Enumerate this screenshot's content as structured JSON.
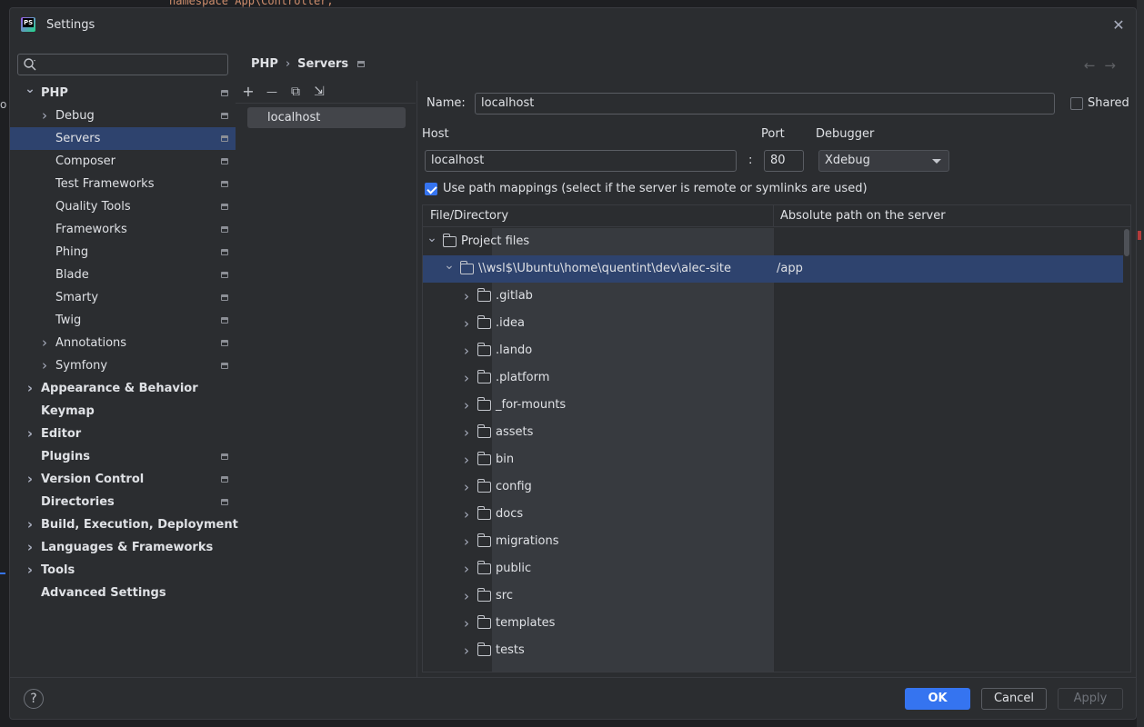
{
  "background": {
    "code_line": "namespace App\\Controller;",
    "left_fragment": "o"
  },
  "dialog": {
    "title": "Settings",
    "app_icon_text": "PS"
  },
  "search": {
    "placeholder": ""
  },
  "tree": [
    {
      "label": "PHP",
      "bold": true,
      "chevron": "down",
      "indent": 0,
      "proj_icon": true,
      "selected": false
    },
    {
      "label": "Debug",
      "bold": false,
      "chevron": "right",
      "indent": 1,
      "proj_icon": true,
      "selected": false
    },
    {
      "label": "Servers",
      "bold": false,
      "chevron": "",
      "indent": 1,
      "proj_icon": true,
      "selected": true
    },
    {
      "label": "Composer",
      "bold": false,
      "chevron": "",
      "indent": 1,
      "proj_icon": true,
      "selected": false
    },
    {
      "label": "Test Frameworks",
      "bold": false,
      "chevron": "",
      "indent": 1,
      "proj_icon": true,
      "selected": false
    },
    {
      "label": "Quality Tools",
      "bold": false,
      "chevron": "",
      "indent": 1,
      "proj_icon": true,
      "selected": false
    },
    {
      "label": "Frameworks",
      "bold": false,
      "chevron": "",
      "indent": 1,
      "proj_icon": true,
      "selected": false
    },
    {
      "label": "Phing",
      "bold": false,
      "chevron": "",
      "indent": 1,
      "proj_icon": true,
      "selected": false
    },
    {
      "label": "Blade",
      "bold": false,
      "chevron": "",
      "indent": 1,
      "proj_icon": true,
      "selected": false
    },
    {
      "label": "Smarty",
      "bold": false,
      "chevron": "",
      "indent": 1,
      "proj_icon": true,
      "selected": false
    },
    {
      "label": "Twig",
      "bold": false,
      "chevron": "",
      "indent": 1,
      "proj_icon": true,
      "selected": false
    },
    {
      "label": "Annotations",
      "bold": false,
      "chevron": "right",
      "indent": 1,
      "proj_icon": true,
      "selected": false
    },
    {
      "label": "Symfony",
      "bold": false,
      "chevron": "right",
      "indent": 1,
      "proj_icon": true,
      "selected": false
    },
    {
      "label": "Appearance & Behavior",
      "bold": true,
      "chevron": "right",
      "indent": 0,
      "proj_icon": false,
      "selected": false
    },
    {
      "label": "Keymap",
      "bold": true,
      "chevron": "",
      "indent": 0,
      "proj_icon": false,
      "selected": false
    },
    {
      "label": "Editor",
      "bold": true,
      "chevron": "right",
      "indent": 0,
      "proj_icon": false,
      "selected": false
    },
    {
      "label": "Plugins",
      "bold": true,
      "chevron": "",
      "indent": 0,
      "proj_icon": true,
      "selected": false
    },
    {
      "label": "Version Control",
      "bold": true,
      "chevron": "right",
      "indent": 0,
      "proj_icon": true,
      "selected": false
    },
    {
      "label": "Directories",
      "bold": true,
      "chevron": "",
      "indent": 0,
      "proj_icon": true,
      "selected": false
    },
    {
      "label": "Build, Execution, Deployment",
      "bold": true,
      "chevron": "right",
      "indent": 0,
      "proj_icon": false,
      "selected": false
    },
    {
      "label": "Languages & Frameworks",
      "bold": true,
      "chevron": "right",
      "indent": 0,
      "proj_icon": false,
      "selected": false
    },
    {
      "label": "Tools",
      "bold": true,
      "chevron": "right",
      "indent": 0,
      "proj_icon": false,
      "selected": false
    },
    {
      "label": "Advanced Settings",
      "bold": true,
      "chevron": "",
      "indent": 0,
      "proj_icon": false,
      "selected": false
    }
  ],
  "breadcrumb": {
    "parent": "PHP",
    "separator": "›",
    "current": "Servers"
  },
  "nav": {
    "back": "←",
    "forward": "→"
  },
  "servers_toolbar": {
    "add": "+",
    "remove": "—",
    "copy": "⧉",
    "import": "⇲"
  },
  "servers": [
    "localhost"
  ],
  "form": {
    "name_label": "Name:",
    "name_value": "localhost",
    "shared_label": "Shared",
    "shared_checked": false,
    "host_label": "Host",
    "host_value": "localhost",
    "colon": ":",
    "port_label": "Port",
    "port_value": "80",
    "debugger_label": "Debugger",
    "debugger_value": "Xdebug",
    "path_mappings_label": "Use path mappings (select if the server is remote or symlinks are used)",
    "path_mappings_checked": true
  },
  "mapping_table": {
    "col_file": "File/Directory",
    "col_server": "Absolute path on the server",
    "rows": [
      {
        "name": "Project files",
        "level": 0,
        "chevron": "down",
        "server_path": "",
        "selected": false
      },
      {
        "name": "\\\\wsl$\\Ubuntu\\home\\quentint\\dev\\alec-site",
        "level": 1,
        "chevron": "down",
        "server_path": "/app",
        "selected": true
      },
      {
        "name": ".gitlab",
        "level": 2,
        "chevron": "right",
        "server_path": "",
        "selected": false
      },
      {
        "name": ".idea",
        "level": 2,
        "chevron": "right",
        "server_path": "",
        "selected": false
      },
      {
        "name": ".lando",
        "level": 2,
        "chevron": "right",
        "server_path": "",
        "selected": false
      },
      {
        "name": ".platform",
        "level": 2,
        "chevron": "right",
        "server_path": "",
        "selected": false
      },
      {
        "name": "_for-mounts",
        "level": 2,
        "chevron": "right",
        "server_path": "",
        "selected": false
      },
      {
        "name": "assets",
        "level": 2,
        "chevron": "right",
        "server_path": "",
        "selected": false
      },
      {
        "name": "bin",
        "level": 2,
        "chevron": "right",
        "server_path": "",
        "selected": false
      },
      {
        "name": "config",
        "level": 2,
        "chevron": "right",
        "server_path": "",
        "selected": false
      },
      {
        "name": "docs",
        "level": 2,
        "chevron": "right",
        "server_path": "",
        "selected": false
      },
      {
        "name": "migrations",
        "level": 2,
        "chevron": "right",
        "server_path": "",
        "selected": false
      },
      {
        "name": "public",
        "level": 2,
        "chevron": "right",
        "server_path": "",
        "selected": false
      },
      {
        "name": "src",
        "level": 2,
        "chevron": "right",
        "server_path": "",
        "selected": false
      },
      {
        "name": "templates",
        "level": 2,
        "chevron": "right",
        "server_path": "",
        "selected": false
      },
      {
        "name": "tests",
        "level": 2,
        "chevron": "right",
        "server_path": "",
        "selected": false
      }
    ]
  },
  "footer": {
    "help": "?",
    "ok": "OK",
    "cancel": "Cancel",
    "apply": "Apply"
  },
  "colors": {
    "accent": "#3574f0",
    "selection": "#2e436e",
    "panel": "#2b2d30"
  }
}
